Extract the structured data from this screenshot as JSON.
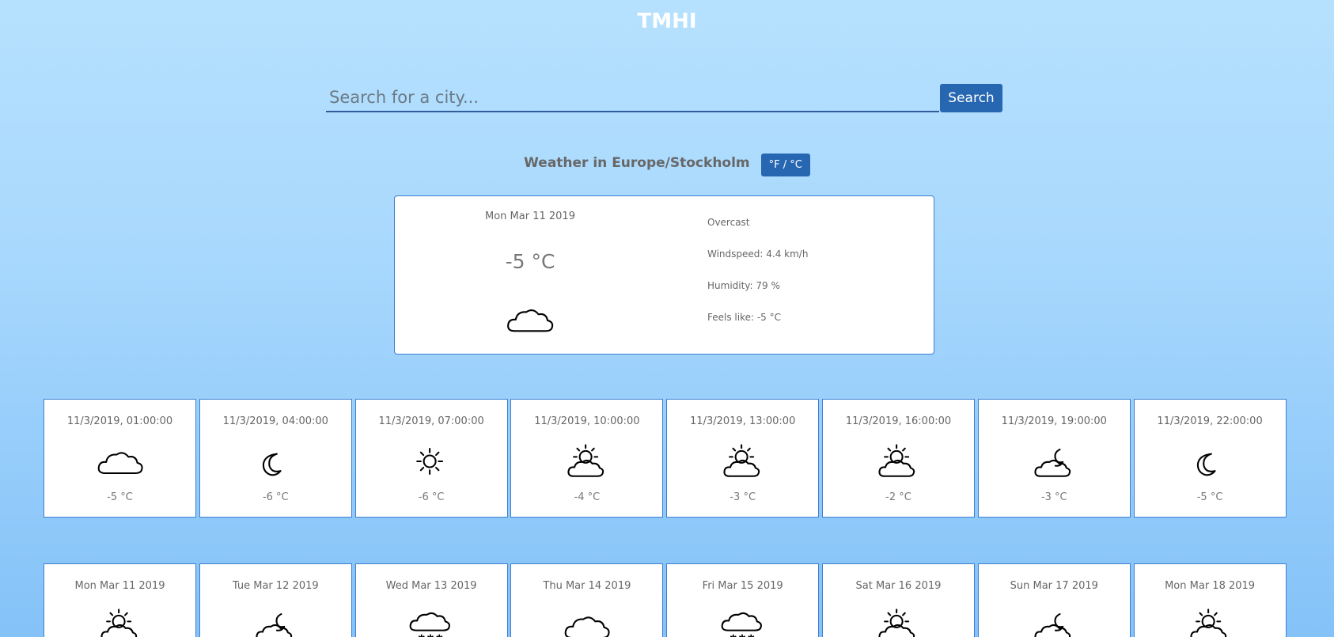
{
  "app": {
    "title": "TMHI"
  },
  "search": {
    "placeholder": "Search for a city...",
    "button_label": "Search"
  },
  "location": {
    "title": "Weather in Europe/Stockholm",
    "unit_toggle_label": "°F / °C"
  },
  "current": {
    "date": "Mon Mar 11 2019",
    "temperature": "-5 °C",
    "icon": "cloud-icon",
    "summary": "Overcast",
    "windspeed": "Windspeed: 4.4 km/h",
    "humidity": "Humidity: 79 %",
    "feels_like": "Feels like: -5 °C"
  },
  "hourly": [
    {
      "time": "11/3/2019, 01:00:00",
      "temp": "-5 °C",
      "icon": "cloud-icon"
    },
    {
      "time": "11/3/2019, 04:00:00",
      "temp": "-6 °C",
      "icon": "moon-icon"
    },
    {
      "time": "11/3/2019, 07:00:00",
      "temp": "-6 °C",
      "icon": "sun-icon"
    },
    {
      "time": "11/3/2019, 10:00:00",
      "temp": "-4 °C",
      "icon": "partly-cloudy-day-icon"
    },
    {
      "time": "11/3/2019, 13:00:00",
      "temp": "-3 °C",
      "icon": "partly-cloudy-day-icon"
    },
    {
      "time": "11/3/2019, 16:00:00",
      "temp": "-2 °C",
      "icon": "partly-cloudy-day-icon"
    },
    {
      "time": "11/3/2019, 19:00:00",
      "temp": "-3 °C",
      "icon": "partly-cloudy-night-icon"
    },
    {
      "time": "11/3/2019, 22:00:00",
      "temp": "-5 °C",
      "icon": "moon-icon"
    }
  ],
  "daily": [
    {
      "date": "Mon Mar 11 2019",
      "icon": "partly-cloudy-day-icon"
    },
    {
      "date": "Tue Mar 12 2019",
      "icon": "partly-cloudy-night-icon"
    },
    {
      "date": "Wed Mar 13 2019",
      "icon": "snow-icon"
    },
    {
      "date": "Thu Mar 14 2019",
      "icon": "cloud-icon"
    },
    {
      "date": "Fri Mar 15 2019",
      "icon": "snow-icon"
    },
    {
      "date": "Sat Mar 16 2019",
      "icon": "partly-cloudy-day-icon"
    },
    {
      "date": "Sun Mar 17 2019",
      "icon": "partly-cloudy-night-icon"
    },
    {
      "date": "Mon Mar 18 2019",
      "icon": "partly-cloudy-day-icon"
    }
  ]
}
